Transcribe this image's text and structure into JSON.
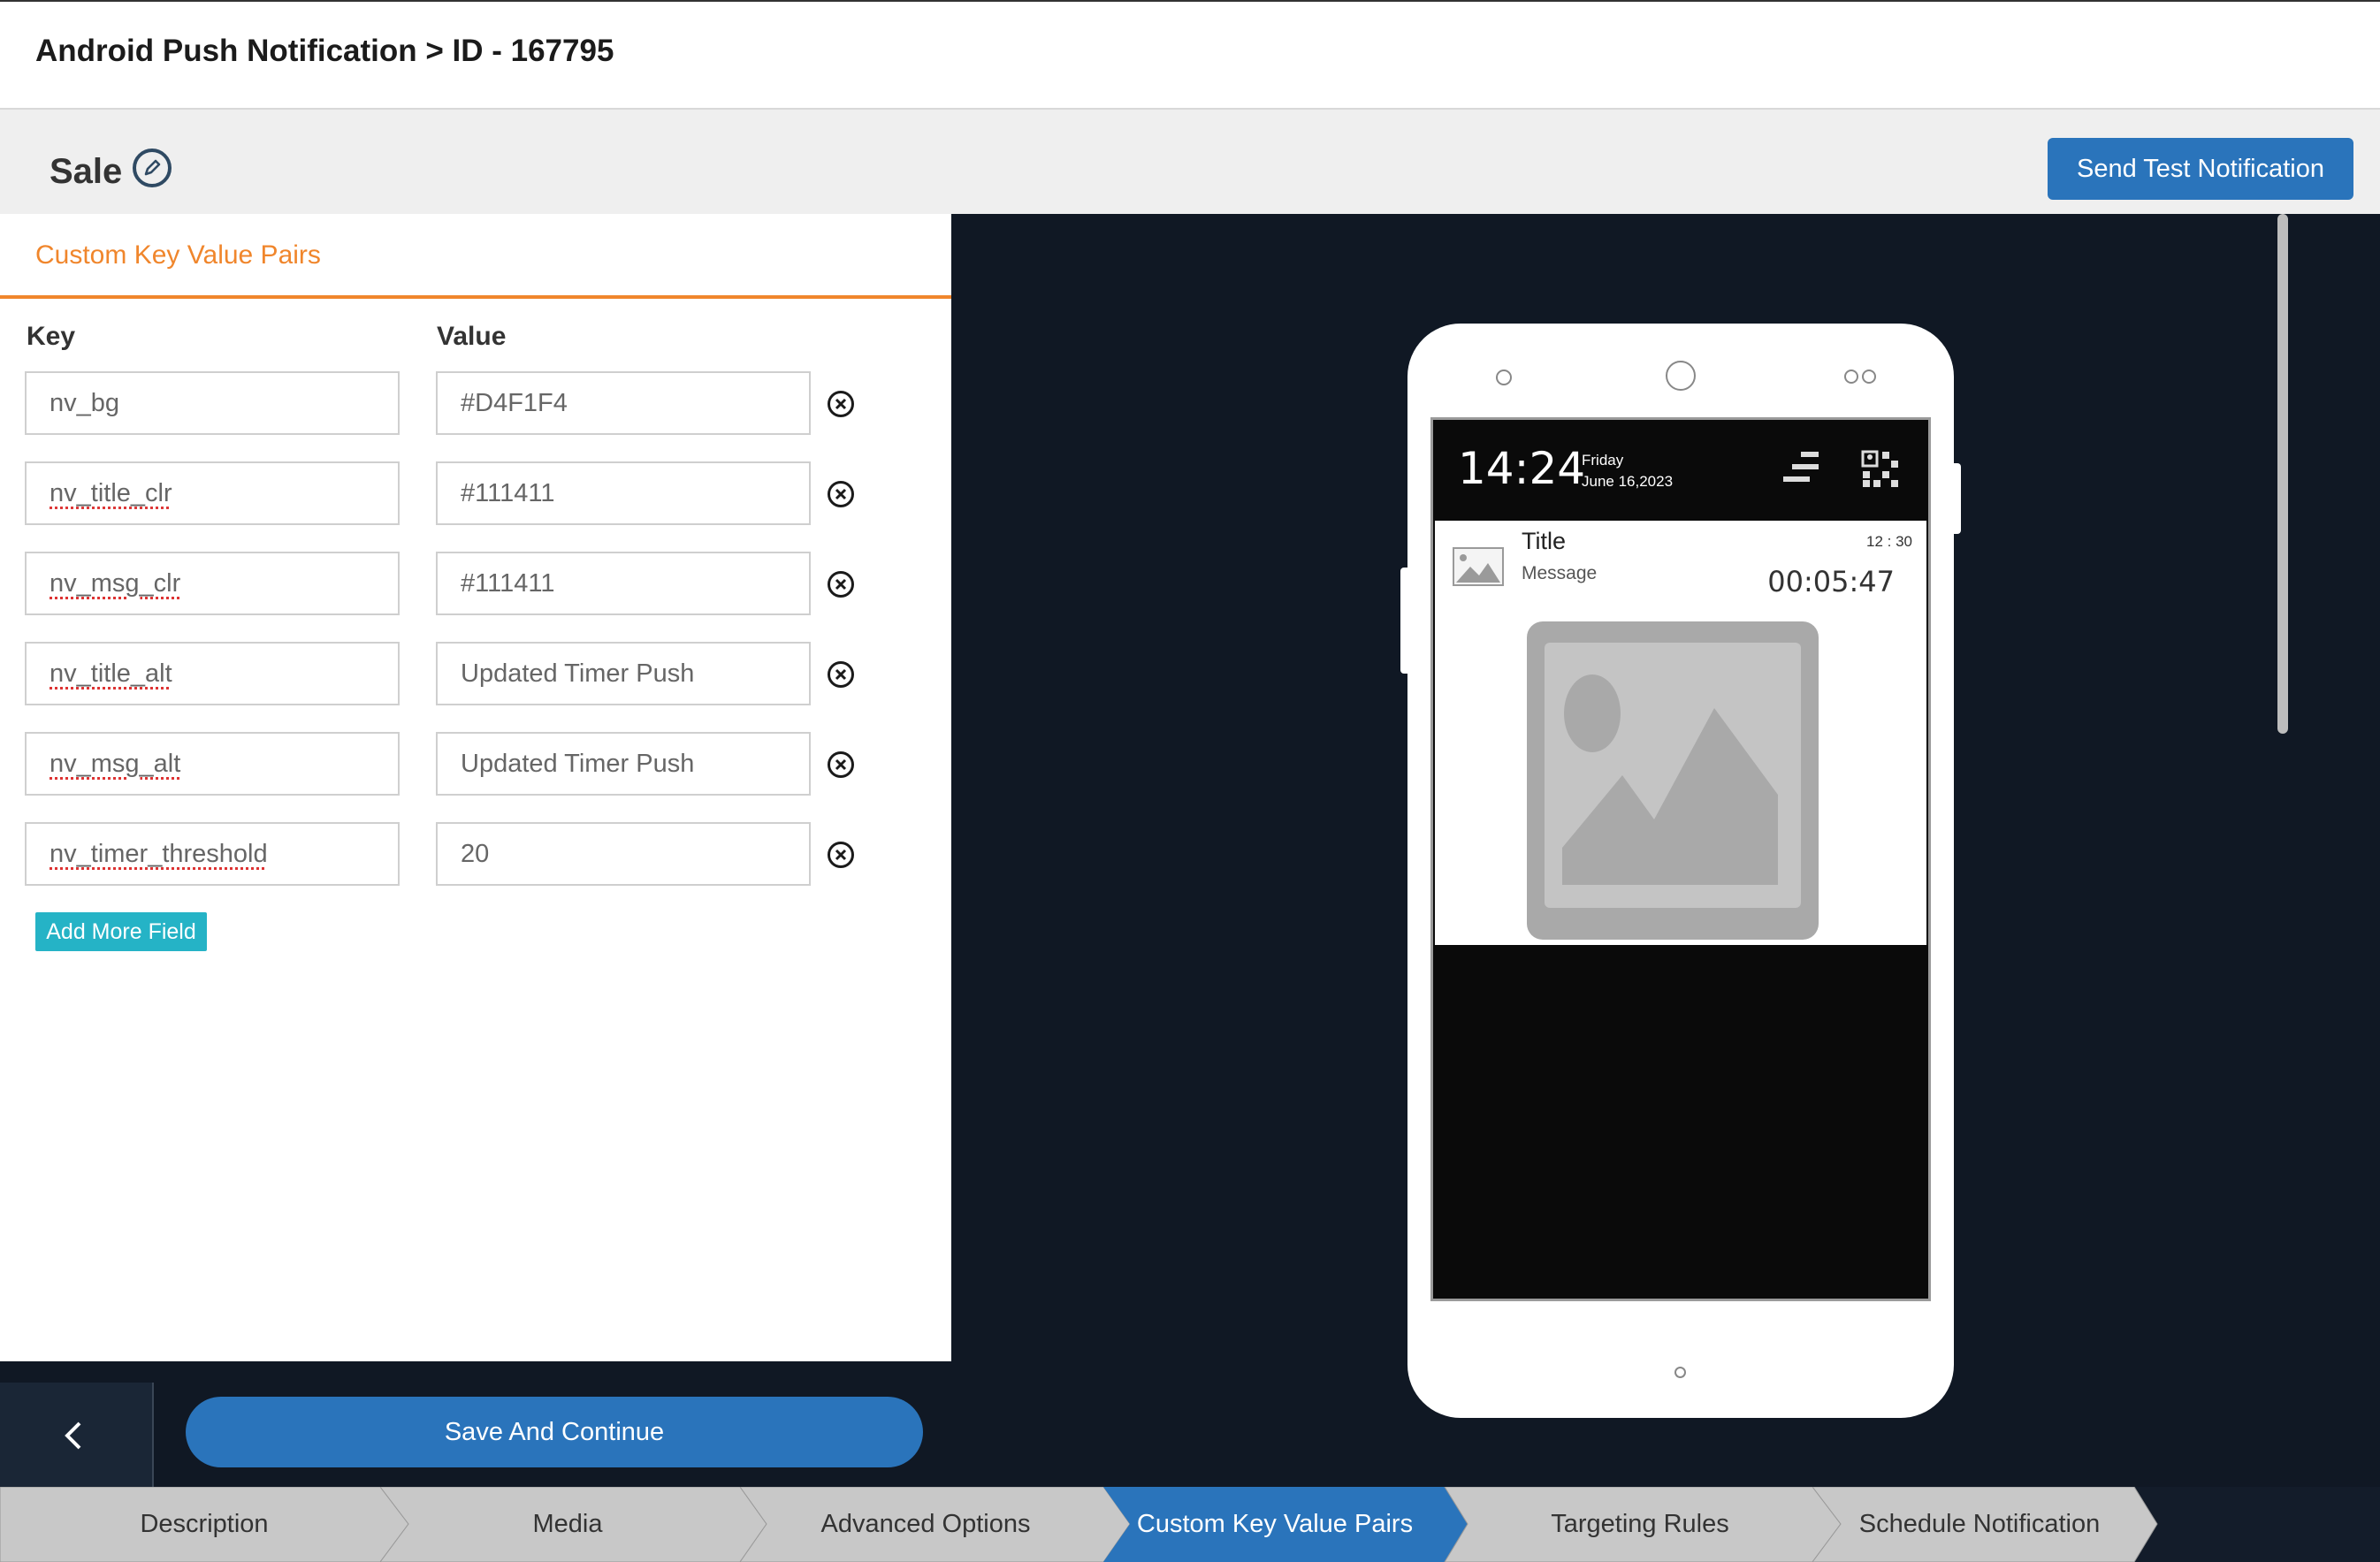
{
  "header": {
    "breadcrumb": "Android Push Notification > ID - 167795"
  },
  "campaign": {
    "name": "Sale",
    "send_test_label": "Send Test Notification"
  },
  "panel": {
    "tab_label": "Custom Key Value Pairs",
    "key_header": "Key",
    "value_header": "Value",
    "rows": [
      {
        "key": "nv_bg",
        "value": "#D4F1F4"
      },
      {
        "key": "nv_title_clr",
        "value": "#111411"
      },
      {
        "key": "nv_msg_clr",
        "value": "#111411"
      },
      {
        "key": "nv_title_alt",
        "value": "Updated Timer Push"
      },
      {
        "key": "nv_msg_alt",
        "value": "Updated Timer Push"
      },
      {
        "key": "nv_timer_threshold",
        "value": "20"
      }
    ],
    "add_field_label": "Add More Field"
  },
  "preview": {
    "time": "14:24",
    "day": "Friday",
    "date": "June 16,2023",
    "notification": {
      "title": "Title",
      "message": "Message",
      "clock": "12 : 30",
      "timer": "00:05:47"
    }
  },
  "footer": {
    "save_label": "Save And Continue"
  },
  "steps": [
    {
      "label": "Description",
      "active": false
    },
    {
      "label": "Media",
      "active": false
    },
    {
      "label": "Advanced Options",
      "active": false
    },
    {
      "label": "Custom Key Value Pairs",
      "active": true
    },
    {
      "label": "Targeting Rules",
      "active": false
    },
    {
      "label": "Schedule Notification",
      "active": false
    }
  ],
  "colors": {
    "accent": "#f0862c",
    "primary": "#2a74bb",
    "teal": "#25b3c6",
    "dark": "#101824"
  }
}
